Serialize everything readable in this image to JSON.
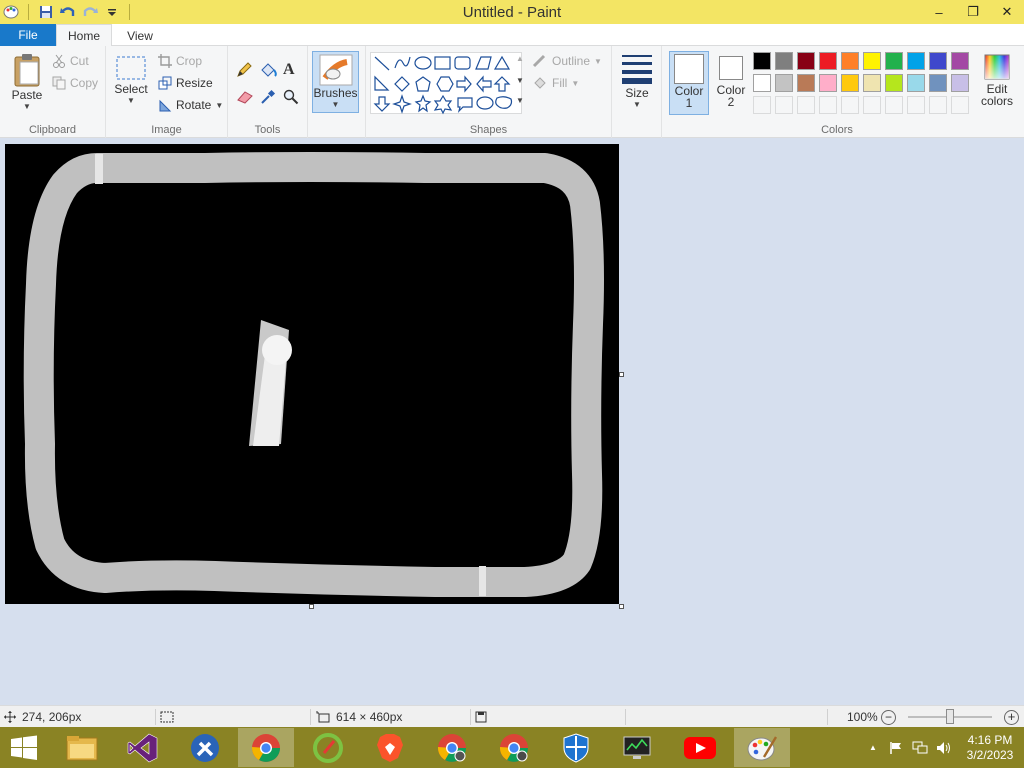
{
  "window": {
    "title": "Untitled - Paint",
    "controls": {
      "minimize": "–",
      "restore": "❐",
      "close": "✕"
    }
  },
  "tabs": {
    "file": "File",
    "home": "Home",
    "view": "View"
  },
  "ribbon": {
    "clipboard": {
      "label": "Clipboard",
      "paste": "Paste",
      "cut": "Cut",
      "copy": "Copy"
    },
    "image": {
      "label": "Image",
      "select": "Select",
      "crop": "Crop",
      "resize": "Resize",
      "rotate": "Rotate"
    },
    "tools": {
      "label": "Tools"
    },
    "brushes": {
      "label": "Brushes"
    },
    "shapes": {
      "label": "Shapes",
      "outline": "Outline",
      "fill": "Fill"
    },
    "size": {
      "label": "Size"
    },
    "colors": {
      "label": "Colors",
      "color1": "Color",
      "color1_num": "1",
      "color2": "Color",
      "color2_num": "2",
      "edit_colors": "Edit",
      "edit_colors2": "colors",
      "palette_row1": [
        "#000000",
        "#7f7f7f",
        "#880015",
        "#ed1c24",
        "#ff7f27",
        "#fff200",
        "#22b14c",
        "#00a2e8",
        "#3f48cc",
        "#a349a4"
      ],
      "palette_row2": [
        "#ffffff",
        "#c3c3c3",
        "#b97a57",
        "#ffaec9",
        "#ffc90e",
        "#efe4b0",
        "#b5e61d",
        "#99d9ea",
        "#7092be",
        "#c8bfe7"
      ]
    }
  },
  "status": {
    "cursor_pos": "274, 206px",
    "canvas_size": "614 × 460px",
    "zoom": "100%",
    "zoom_minus": "−",
    "zoom_plus": "+"
  },
  "taskbar": {
    "time": "4:16 PM",
    "date": "3/2/2023",
    "tray_arrow": "▲"
  },
  "colors": {
    "title_bar": "#f3e564",
    "file_tab": "#1979ca",
    "taskbar": "#8a8324",
    "stroke": "#c0c0c0"
  }
}
